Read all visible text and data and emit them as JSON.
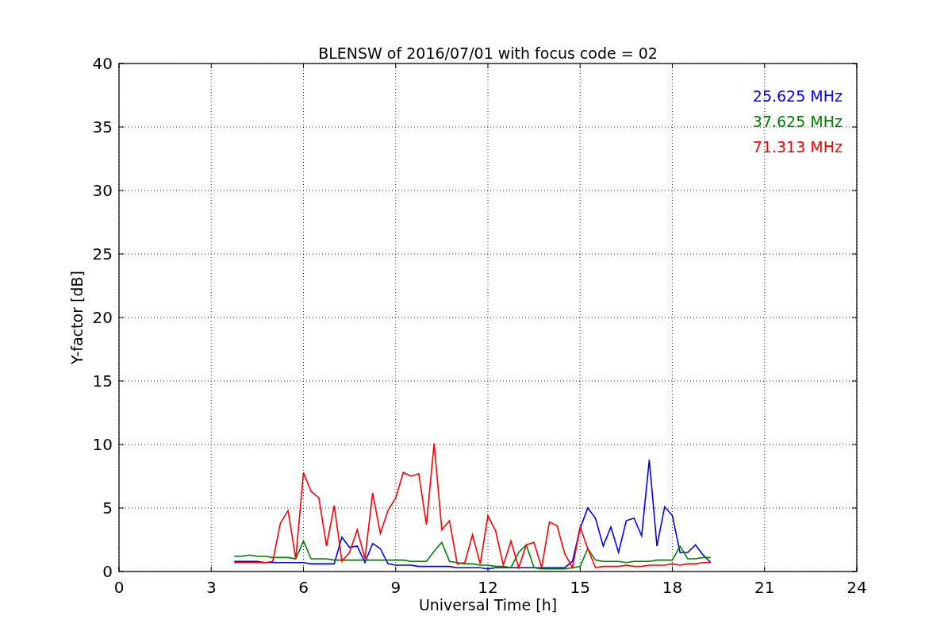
{
  "figure": {
    "chart_data": {
      "type": "line",
      "title": "BLENSW of 2016/07/01 with focus code = 02",
      "xlabel": "Universal Time [h]",
      "ylabel": "Y-factor [dB]",
      "x": [
        3.75,
        4,
        4.25,
        4.5,
        4.75,
        5,
        5.25,
        5.5,
        5.75,
        6,
        6.25,
        6.5,
        6.75,
        7,
        7.25,
        7.5,
        7.75,
        8,
        8.25,
        8.5,
        8.75,
        9,
        9.25,
        9.5,
        9.75,
        10,
        10.25,
        10.5,
        10.75,
        11,
        11.25,
        11.5,
        11.75,
        12,
        12.25,
        12.5,
        12.75,
        13,
        13.25,
        13.5,
        13.75,
        14,
        14.25,
        14.5,
        14.75,
        15,
        15.25,
        15.5,
        15.75,
        16,
        16.25,
        16.5,
        16.75,
        17,
        17.25,
        17.5,
        17.75,
        18,
        18.25,
        18.5,
        18.75,
        19,
        19.25
      ],
      "series": [
        {
          "name": "25.625 MHz",
          "color": "#0000ff",
          "values": [
            0.8,
            0.8,
            0.8,
            0.8,
            0.7,
            0.7,
            0.7,
            0.7,
            0.7,
            0.7,
            0.6,
            0.6,
            0.6,
            0.6,
            2.7,
            1.9,
            2.0,
            0.7,
            2.2,
            1.8,
            0.6,
            0.5,
            0.5,
            0.5,
            0.4,
            0.4,
            0.4,
            0.4,
            0.4,
            0.3,
            0.3,
            0.3,
            0.3,
            0.2,
            0.3,
            0.3,
            0.3,
            0.3,
            0.3,
            0.3,
            0.3,
            0.3,
            0.3,
            0.3,
            0.8,
            3.4,
            5.0,
            4.2,
            2.0,
            3.5,
            1.5,
            4.0,
            4.2,
            2.8,
            8.8,
            2.0,
            5.1,
            4.4,
            1.5,
            1.5,
            2.1,
            1.3,
            0.7
          ]
        },
        {
          "name": "37.625 MHz",
          "color": "#008000",
          "values": [
            1.2,
            1.2,
            1.3,
            1.2,
            1.2,
            1.1,
            1.1,
            1.1,
            1.0,
            2.4,
            1.0,
            1.0,
            1.0,
            0.9,
            0.9,
            0.9,
            0.9,
            0.9,
            0.9,
            0.9,
            0.9,
            0.9,
            0.9,
            0.8,
            0.8,
            0.8,
            1.6,
            2.3,
            0.8,
            0.7,
            0.6,
            0.6,
            0.5,
            0.5,
            0.4,
            0.4,
            0.3,
            1.5,
            2.1,
            0.3,
            0.2,
            0.2,
            0.2,
            0.2,
            0.3,
            0.4,
            1.8,
            0.9,
            0.8,
            0.8,
            0.8,
            0.7,
            0.8,
            0.8,
            0.8,
            0.9,
            0.9,
            0.9,
            2.0,
            1.0,
            1.0,
            1.1,
            1.1
          ]
        },
        {
          "name": "71.313 MHz",
          "color": "#ff0000",
          "values": [
            0.7,
            0.7,
            0.7,
            0.7,
            0.7,
            0.8,
            3.8,
            4.8,
            1.0,
            7.8,
            6.3,
            5.8,
            2.0,
            5.2,
            0.8,
            1.5,
            3.3,
            1.0,
            6.2,
            3.0,
            4.8,
            5.8,
            7.8,
            7.5,
            7.7,
            3.7,
            10.1,
            3.3,
            4.0,
            0.6,
            0.7,
            2.9,
            0.6,
            4.4,
            3.2,
            0.5,
            2.4,
            0.3,
            2.1,
            2.3,
            0.3,
            3.9,
            3.6,
            1.4,
            0.3,
            3.5,
            1.8,
            0.3,
            0.4,
            0.4,
            0.4,
            0.5,
            0.4,
            0.4,
            0.5,
            0.5,
            0.5,
            0.6,
            0.5,
            0.6,
            0.6,
            0.7,
            0.7
          ]
        }
      ],
      "xlim": [
        0,
        24
      ],
      "ylim": [
        0,
        40
      ],
      "xticks": [
        0,
        3,
        6,
        9,
        12,
        15,
        18,
        21,
        24
      ],
      "yticks": [
        0,
        5,
        10,
        15,
        20,
        25,
        30,
        35,
        40
      ],
      "grid": true
    }
  }
}
